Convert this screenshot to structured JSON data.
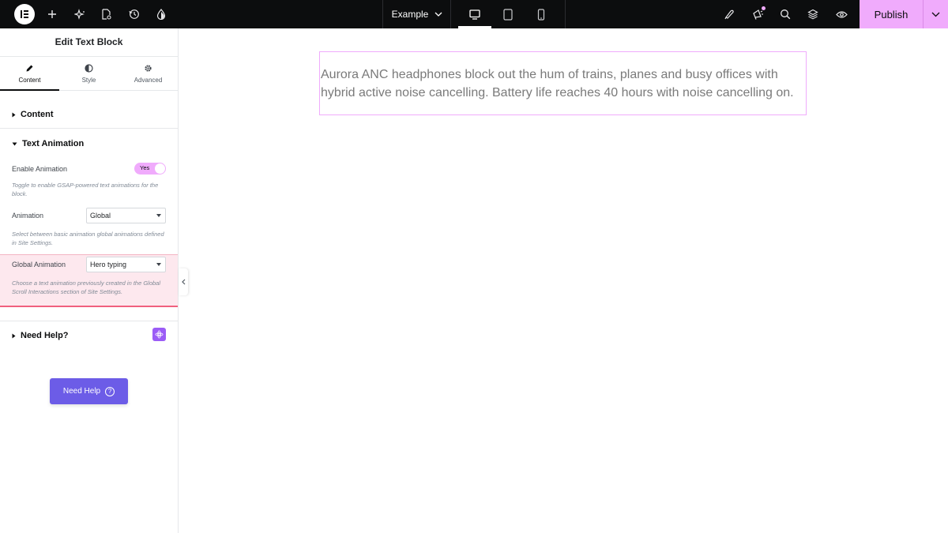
{
  "topbar": {
    "page_name": "Example",
    "publish_label": "Publish",
    "icons": [
      "elementor-logo-icon",
      "add-element-icon",
      "ai-sparkle-icon",
      "page-settings-icon",
      "history-icon",
      "site-settings-icon",
      "chevron-down-icon",
      "desktop-icon",
      "tablet-icon",
      "mobile-icon",
      "brush-icon",
      "megaphone-icon",
      "search-icon",
      "structure-layers-icon",
      "preview-eye-icon",
      "publish-options-chevron-icon"
    ],
    "active_device": "desktop",
    "accent_color": "#f0abfc"
  },
  "panel": {
    "title": "Edit Text Block",
    "tabs": [
      {
        "label": "Content",
        "icon": "pencil-icon",
        "active": true
      },
      {
        "label": "Style",
        "icon": "half-circle-icon",
        "active": false
      },
      {
        "label": "Advanced",
        "icon": "gear-icon",
        "active": false
      }
    ],
    "sections": {
      "content": {
        "label": "Content",
        "expanded": false
      },
      "text_animation": {
        "label": "Text Animation",
        "expanded": true
      },
      "need_help": {
        "label": "Need Help?",
        "expanded": false
      }
    },
    "controls": {
      "enable_animation": {
        "label": "Enable Animation",
        "toggle_text": "Yes",
        "description": "Toggle to enable GSAP-powered text animations for the block."
      },
      "animation": {
        "label": "Animation",
        "value": "Global",
        "description": "Select between basic animation global animations defined in Site Settings."
      },
      "global_animation": {
        "label": "Global Animation",
        "value": "Hero typing",
        "description": "Choose a text animation previously created in the Global Scroll Interactions section of Site Settings."
      }
    },
    "need_help_button": "Need Help",
    "need_help_icon": "question-circle-icon",
    "highlight_color": "#fde8ee"
  },
  "canvas": {
    "text": "Aurora ANC headphones block out the hum of trains, planes and busy offices with hybrid active noise cancelling. Battery life reaches 40 hours with noise cancelling on."
  }
}
